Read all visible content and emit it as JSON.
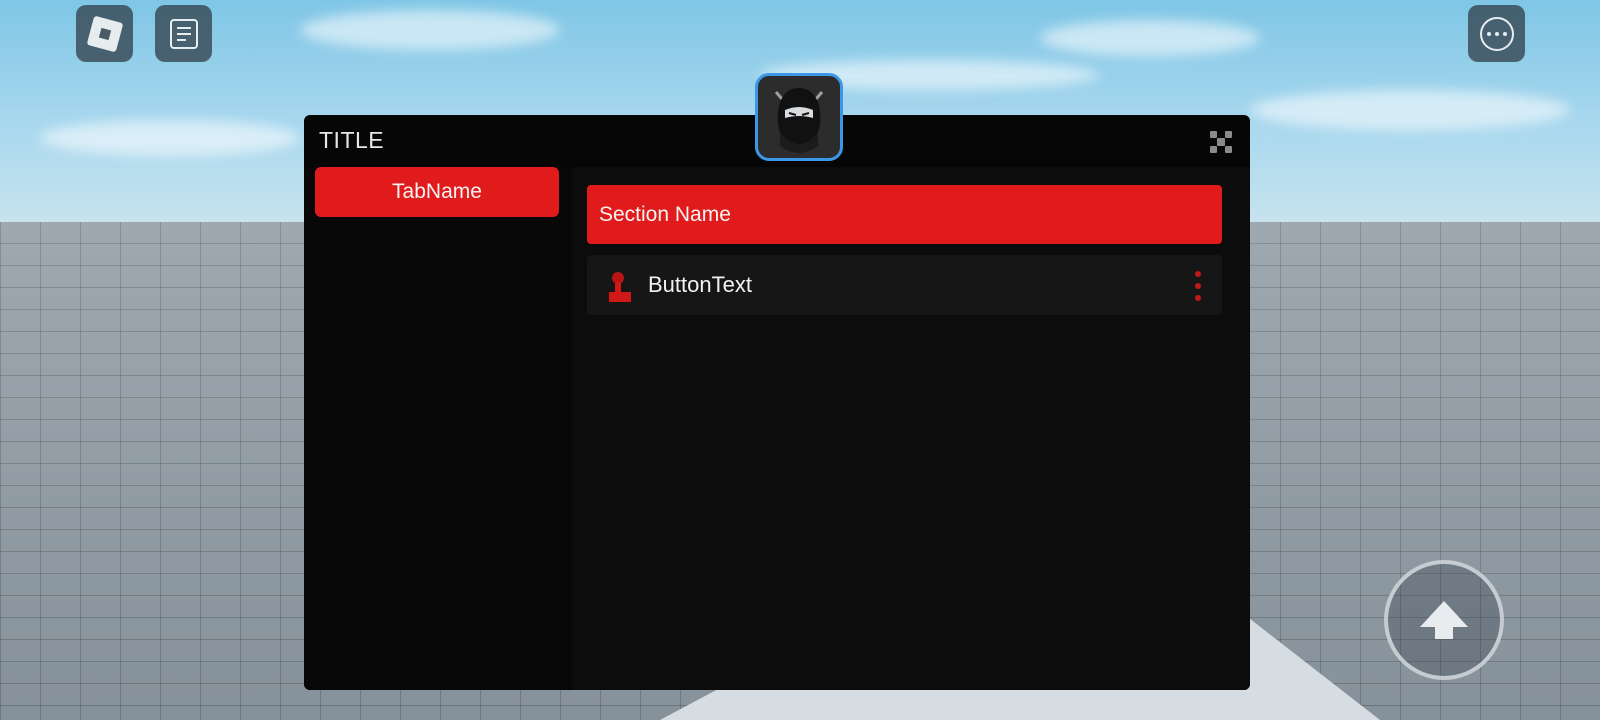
{
  "window": {
    "title": "TITLE"
  },
  "sidebar": {
    "tabs": [
      {
        "label": "TabName"
      }
    ]
  },
  "content": {
    "section": {
      "name": "Section Name"
    },
    "button": {
      "text": "ButtonText"
    }
  },
  "icons": {
    "roblox_menu": "roblox-logo-icon",
    "chat": "chat-icon",
    "more": "more-options-icon",
    "close": "close-icon",
    "button": "touch-icon",
    "button_menu": "vertical-dots-icon",
    "jump": "jump-arrow-icon",
    "avatar": "ninja-avatar-icon"
  },
  "colors": {
    "accent": "#e11b1b",
    "window_bg": "#060606",
    "panel_bg": "#0c0c0c",
    "row_bg": "#161616",
    "avatar_border": "#3d97e8"
  }
}
